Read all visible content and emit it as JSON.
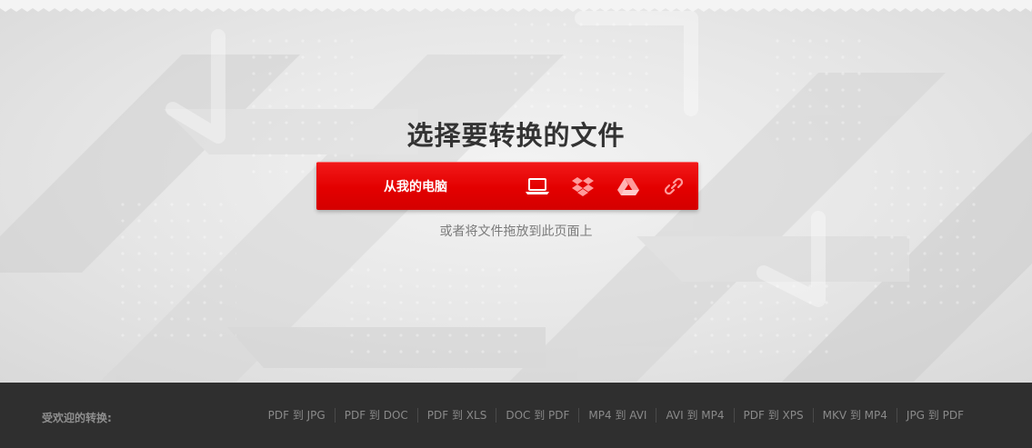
{
  "hero": {
    "title": "选择要转换的文件",
    "drop_hint": "或者将文件拖放到此页面上"
  },
  "upload": {
    "main_label": "从我的电脑",
    "sources": [
      {
        "icon": "laptop-icon",
        "name": "laptop"
      },
      {
        "icon": "dropbox-icon",
        "name": "dropbox"
      },
      {
        "icon": "google-drive-icon",
        "name": "google-drive"
      },
      {
        "icon": "link-icon",
        "name": "url-link"
      }
    ]
  },
  "footer": {
    "label": "受欢迎的转换:",
    "links": [
      "PDF 到 JPG",
      "PDF 到 DOC",
      "PDF 到 XLS",
      "DOC 到 PDF",
      "MP4 到 AVI",
      "AVI 到 MP4",
      "PDF 到 XPS",
      "MKV 到 MP4",
      "JPG 到 PDF"
    ]
  },
  "colors": {
    "accent_red": "#e30000",
    "footer_bg": "#2f2f2f",
    "title_text": "#333333",
    "hint_text": "#7b7b7b"
  }
}
